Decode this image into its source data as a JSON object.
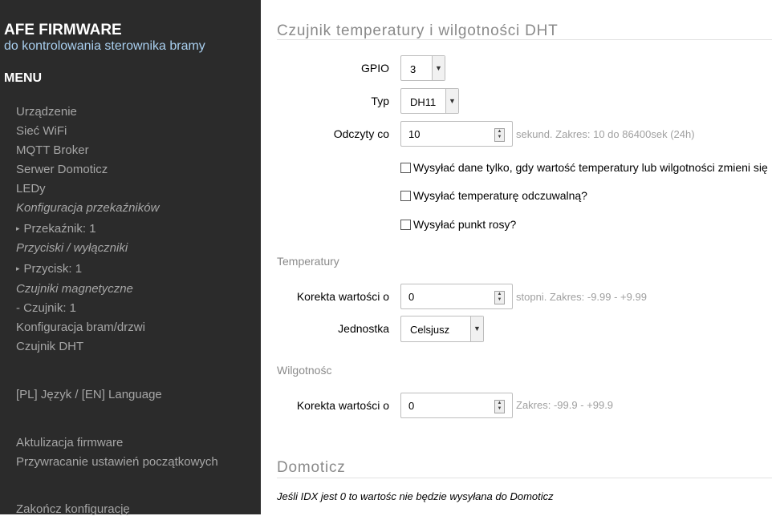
{
  "sidebar": {
    "brand": "AFE FIRMWARE",
    "tagline": "do kontrolowania sterownika bramy",
    "menu_title": "MENU",
    "items": [
      {
        "label": "Urządzenie"
      },
      {
        "label": "Sieć WiFi"
      },
      {
        "label": "MQTT Broker"
      },
      {
        "label": "Serwer Domoticz"
      },
      {
        "label": "LEDy"
      },
      {
        "label": "Konfiguracja przekaźników"
      },
      {
        "label": "Przekaźnik: 1"
      },
      {
        "label": "Przyciski / wyłączniki"
      },
      {
        "label": "Przycisk: 1"
      },
      {
        "label": "Czujniki magnetyczne"
      },
      {
        "label": "- Czujnik: 1"
      },
      {
        "label": "Konfiguracja bram/drzwi"
      },
      {
        "label": "Czujnik DHT"
      },
      {
        "label": "[PL] Język / [EN] Language"
      },
      {
        "label": "Aktulizacja firmware"
      },
      {
        "label": "Przywracanie ustawień początkowych"
      },
      {
        "label": "Zakończ konfigurację"
      }
    ]
  },
  "dht": {
    "title": "Czujnik temperatury i wilgotności DHT",
    "gpio": {
      "label": "GPIO",
      "value": "3"
    },
    "type": {
      "label": "Typ",
      "value": "DH11"
    },
    "interval": {
      "label": "Odczyty co",
      "value": "10",
      "hint": "sekund. Zakres: 10 do 86400sek (24h)"
    },
    "checks": [
      {
        "label": "Wysyłać dane tylko, gdy wartość temperatury lub wilgotności zmieni się",
        "checked": false
      },
      {
        "label": "Wysyłać temperaturę odczuwalną?",
        "checked": false
      },
      {
        "label": "Wysyłać punkt rosy?",
        "checked": false
      }
    ]
  },
  "temperature": {
    "heading": "Temperatury",
    "correction": {
      "label": "Korekta wartości o",
      "value": "0",
      "hint": "stopni. Zakres: -9.99 - +9.99"
    },
    "unit": {
      "label": "Jednostka",
      "value": "Celsjusz"
    }
  },
  "humidity": {
    "heading": "Wilgotnośc",
    "correction": {
      "label": "Korekta wartości o",
      "value": "0",
      "hint": "Zakres: -99.9 - +99.9"
    }
  },
  "domoticz": {
    "title": "Domoticz",
    "note": "Jeśli IDX jest 0 to wartośc nie będzie wysyłana do Domoticz"
  },
  "icons": {
    "dropdown": "chevron-down-icon",
    "spinner": "spinner-arrows-icon",
    "bullet": "triangle-right-icon"
  },
  "colors": {
    "sidebar_bg": "#2b2b2b",
    "tagline": "#a9cfef",
    "nav_text": "#a6a6a6",
    "section_title": "#8a8a8a",
    "hint": "#a0a0a0"
  }
}
